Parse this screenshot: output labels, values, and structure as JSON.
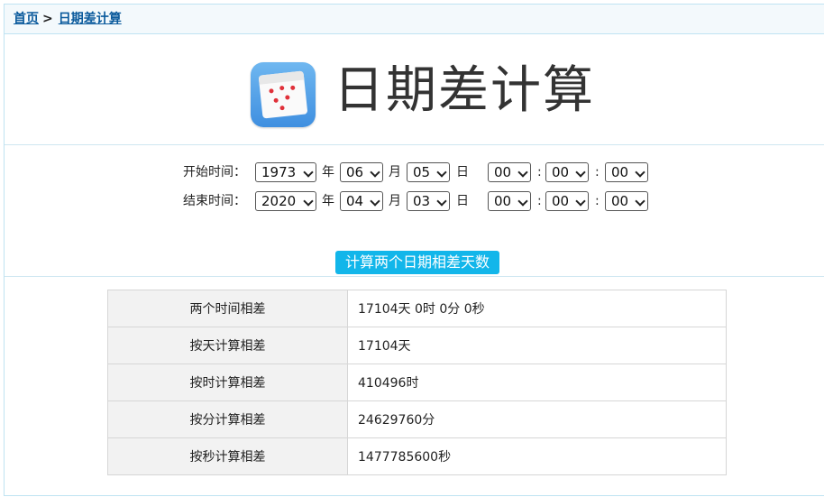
{
  "breadcrumb": {
    "home": "首页",
    "separator": ">",
    "current": "日期差计算"
  },
  "header": {
    "icon": "calendar-app-icon",
    "title": "日期差计算"
  },
  "form": {
    "start": {
      "label": "开始时间：",
      "year": "1973",
      "month": "06",
      "day": "05",
      "hour": "00",
      "minute": "00",
      "second": "00"
    },
    "end": {
      "label": "结束时间：",
      "year": "2020",
      "month": "04",
      "day": "03",
      "hour": "00",
      "minute": "00",
      "second": "00"
    },
    "units": {
      "year": "年",
      "month": "月",
      "day": "日",
      "colon": ":"
    },
    "button_label": "计算两个日期相差天数"
  },
  "results": [
    {
      "key": "两个时间相差",
      "value": "17104天 0时 0分 0秒"
    },
    {
      "key": "按天计算相差",
      "value": "17104天"
    },
    {
      "key": "按时计算相差",
      "value": "410496时"
    },
    {
      "key": "按分计算相差",
      "value": "24629760分"
    },
    {
      "key": "按秒计算相差",
      "value": "1477785600秒"
    }
  ],
  "colors": {
    "accent": "#12b6ea",
    "link": "#0a5a9c",
    "border": "#bfe3f2",
    "icon_red": "#e0313a",
    "icon_blue": "#3f8fe0"
  }
}
